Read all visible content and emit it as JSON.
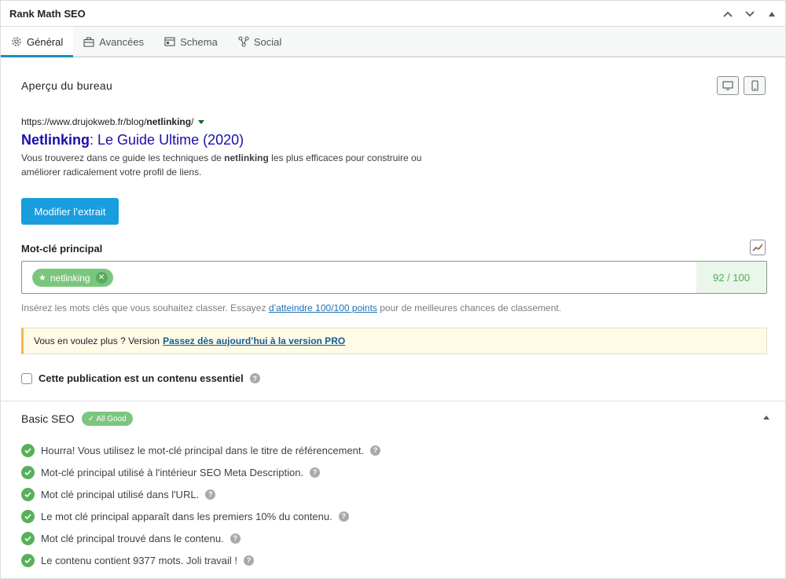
{
  "panel": {
    "title": "Rank Math SEO"
  },
  "tabs": [
    {
      "label": "Général",
      "icon": "gear-icon",
      "active": true
    },
    {
      "label": "Avancées",
      "icon": "toolbox-icon",
      "active": false
    },
    {
      "label": "Schema",
      "icon": "schema-icon",
      "active": false
    },
    {
      "label": "Social",
      "icon": "social-icon",
      "active": false
    }
  ],
  "preview": {
    "heading": "Aperçu du bureau",
    "url_prefix": "https://www.drujokweb.fr/blog/",
    "url_keyword": "netlinking",
    "url_suffix": "/",
    "title_keyword": "Netlinking",
    "title_rest": ": Le Guide Ultime (2020)",
    "desc_part1": "Vous trouverez dans ce guide les techniques de ",
    "desc_keyword": "netlinking",
    "desc_part2": " les plus efficaces pour construire ou améliorer radicalement votre profil de liens.",
    "edit_button": "Modifier l’extrait"
  },
  "focus_keyword": {
    "label": "Mot-clé principal",
    "keyword": "netlinking",
    "score": "92 / 100",
    "hint_before": "Insérez les mots clés que vous souhaitez classer. Essayez ",
    "hint_link": "d’atteindre 100/100 points",
    "hint_after": " pour de meilleures chances de classement."
  },
  "notice": {
    "text": "Vous en voulez plus ? Version",
    "link": "Passez dès aujourd’hui à la version PRO"
  },
  "pillar": {
    "label": "Cette publication est un contenu essentiel",
    "checked": false
  },
  "basic_seo": {
    "title": "Basic SEO",
    "badge": "✓ All Good",
    "checks": [
      "Hourra!  Vous utilisez le mot-clé principal dans le titre de référencement.",
      "Mot-clé principal utilisé à l'intérieur SEO Meta Description.",
      "Mot clé principal utilisé dans l'URL.",
      "Le mot clé principal apparaît dans les premiers 10% du contenu.",
      "Mot clé principal trouvé dans le contenu.",
      "Le contenu contient 9377 mots. Joli travail !"
    ]
  },
  "colors": {
    "primary": "#1a9ddf",
    "success": "#58b05b",
    "link": "#1a0dab"
  }
}
